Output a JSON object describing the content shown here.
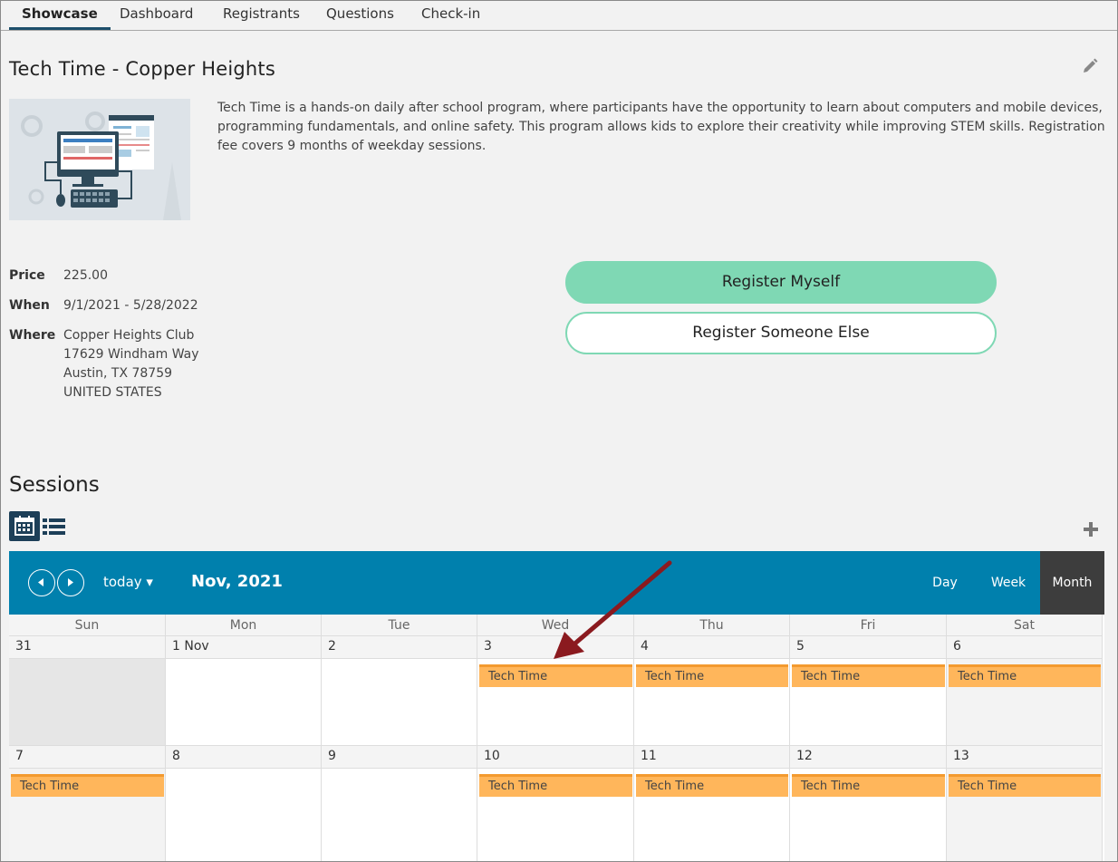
{
  "tabs": [
    "Showcase",
    "Dashboard",
    "Registrants",
    "Questions",
    "Check-in"
  ],
  "program": {
    "title": "Tech Time - Copper Heights",
    "description": "Tech Time is a hands-on daily after school program, where participants have the opportunity to learn about computers and mobile devices, programming fundamentals, and online safety. This program allows kids to explore their creativity while improving STEM skills. Registration fee covers 9 months of weekday sessions."
  },
  "details": {
    "price_label": "Price",
    "price": "225.00",
    "when_label": "When",
    "when": "9/1/2021 - 5/28/2022",
    "where_label": "Where",
    "where_lines": [
      "Copper Heights Club",
      "17629 Windham Way",
      "Austin, TX 78759",
      "UNITED STATES"
    ]
  },
  "buttons": {
    "register_myself": "Register Myself",
    "register_someone": "Register Someone Else"
  },
  "sessions": {
    "title": "Sessions"
  },
  "calendar": {
    "today_label": "today ▾",
    "month_title": "Nov, 2021",
    "views": [
      "Day",
      "Week",
      "Month"
    ],
    "active_view": "Month",
    "weekdays": [
      "Sun",
      "Mon",
      "Tue",
      "Wed",
      "Thu",
      "Fri",
      "Sat"
    ],
    "week1": [
      "31",
      "1 Nov",
      "2",
      "3",
      "4",
      "5",
      "6"
    ],
    "week2": [
      "7",
      "8",
      "9",
      "10",
      "11",
      "12",
      "13"
    ],
    "event_label": "Tech Time"
  },
  "colors": {
    "accent": "#0080ad",
    "button": "#7fd8b4",
    "event": "#ffb65b",
    "arrow": "#8b1a1f"
  }
}
